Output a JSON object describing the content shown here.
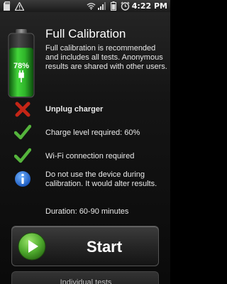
{
  "status_bar": {
    "time": "4:22",
    "time_suffix": "PM"
  },
  "header": {
    "title": "Full Calibration",
    "intro": "Full calibration is recommended and includes all tests. Anonymous results are shared with other users."
  },
  "battery": {
    "percent_label": "78%",
    "level": 0.78,
    "color": "#2fc42f"
  },
  "requirements": [
    {
      "icon": "red-x-icon",
      "text": "Unplug charger",
      "status": "fail"
    },
    {
      "icon": "green-check-icon",
      "text": "Charge level required: 60%",
      "status": "ok"
    },
    {
      "icon": "green-check-icon",
      "text": "Wi-Fi connection required",
      "status": "ok"
    },
    {
      "icon": "info-icon",
      "text": "Do not use the device during calibration. It would alter results.",
      "status": "info"
    }
  ],
  "duration": "Duration: 60-90 minutes",
  "buttons": {
    "start_label": "Start",
    "individual_label": "Individual tests"
  },
  "colors": {
    "warning": "#f2d51c",
    "ok": "#55b43c",
    "fail": "#cc2a1a",
    "info": "#1f6fd6"
  }
}
